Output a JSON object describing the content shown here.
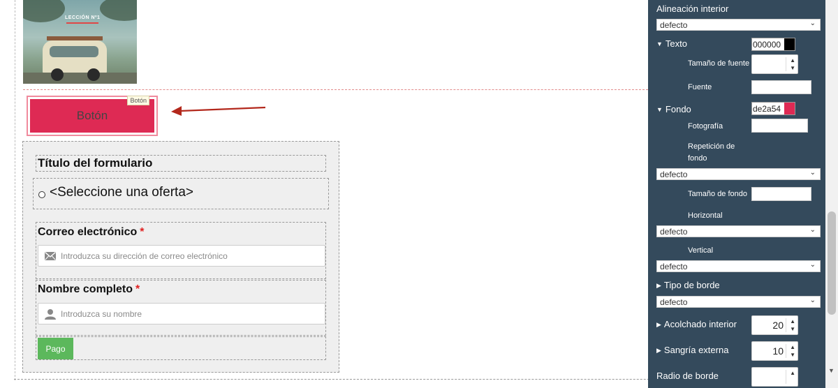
{
  "canvas": {
    "hero_caption": "LECCIÓN Nº1",
    "button": {
      "label": "Botón",
      "tag": "Botón",
      "color": "#de2a54"
    },
    "form": {
      "title": "Título del formulario",
      "offer_label": "<Seleccione una oferta>",
      "email": {
        "label": "Correo electrónico",
        "required": "*",
        "placeholder": "Introduzca su dirección de correo electrónico"
      },
      "name": {
        "label": "Nombre completo",
        "required": "*",
        "placeholder": "Introduzca su nombre"
      },
      "submit_label": "Pago",
      "submit_color": "#5cb85c"
    }
  },
  "panel": {
    "inner_alignment": {
      "label": "Alineación interior",
      "value": "defecto"
    },
    "text": {
      "label": "Texto",
      "color_value": "000000",
      "swatch": "#000000",
      "font_size_label": "Tamaño de fuente",
      "font_label": "Fuente"
    },
    "background": {
      "label": "Fondo",
      "color_value": "de2a54",
      "swatch": "#de2a54",
      "photo_label": "Fotografía",
      "repeat_label": "Repetición de fondo",
      "repeat_value": "defecto",
      "size_label": "Tamaño de fondo",
      "horizontal_label": "Horizontal",
      "horizontal_value": "defecto",
      "vertical_label": "Vertical",
      "vertical_value": "defecto"
    },
    "border_type": {
      "label": "Tipo de borde",
      "value": "defecto"
    },
    "padding": {
      "label": "Acolchado interior",
      "value": "20"
    },
    "margin": {
      "label": "Sangría externa",
      "value": "10"
    },
    "radius": {
      "label": "Radio de borde"
    },
    "accent_bg": "#344a5c"
  }
}
